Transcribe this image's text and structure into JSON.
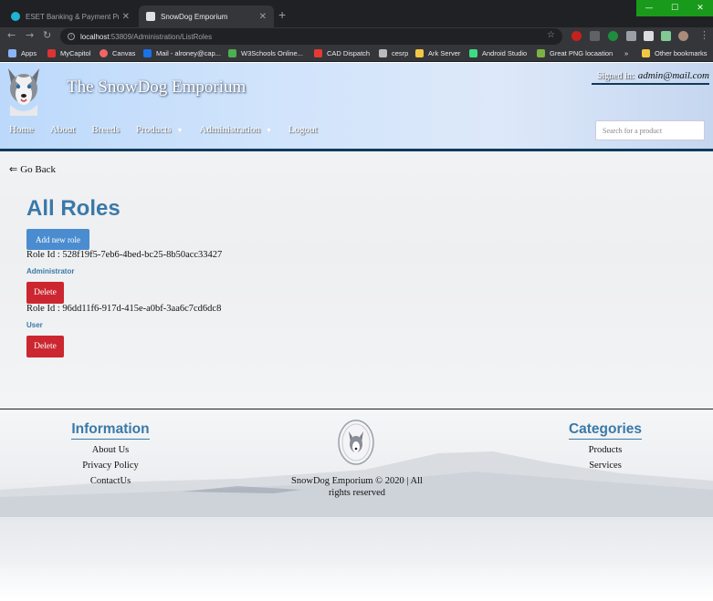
{
  "browser": {
    "tabs": [
      {
        "title": "ESET Banking & Payment Protect",
        "active": false
      },
      {
        "title": "SnowDog Emporium",
        "active": true
      }
    ],
    "url_host": "localhost",
    "url_path": ":53809/Administration/ListRoles",
    "bookmarks": [
      "Apps",
      "MyCapitol",
      "Canvas",
      "Mail - alroney@cap...",
      "W3Schools Online...",
      "CAD Dispatch",
      "cesrp",
      "Ark Server",
      "Android Studio",
      "Great PNG locaation",
      "»",
      "Other bookmarks"
    ]
  },
  "header": {
    "site_title": "The SnowDog Emporium",
    "signed_in_label": "Signed in:",
    "signed_in_email": "admin@mail.com",
    "nav": [
      "Home",
      "About",
      "Breeds",
      "Products",
      "Administration",
      "Logout"
    ],
    "search_placeholder": "Search for a product"
  },
  "main": {
    "go_back": "Go Back",
    "title": "All Roles",
    "add_button": "Add new role",
    "roles": [
      {
        "id_label": "Role Id : 528f19f5-7eb6-4bed-bc25-8b50acc33427",
        "name": "Administrator",
        "delete": "Delete"
      },
      {
        "id_label": "Role Id : 96dd11f6-917d-415e-a0bf-3aa6c7cd6dc8",
        "name": "User",
        "delete": "Delete"
      }
    ]
  },
  "footer": {
    "info_title": "Information",
    "info_links": [
      "About Us",
      "Privacy Policy",
      "ContactUs"
    ],
    "copyright": "SnowDog Emporium © 2020 | All rights reserved",
    "categories_title": "Categories",
    "category_links": [
      "Products",
      "Services"
    ]
  },
  "colors": {
    "accent_blue": "#3a79a8",
    "add_button": "#4a8ccf",
    "delete_button": "#cc2730",
    "header_rule": "#103a5c"
  }
}
